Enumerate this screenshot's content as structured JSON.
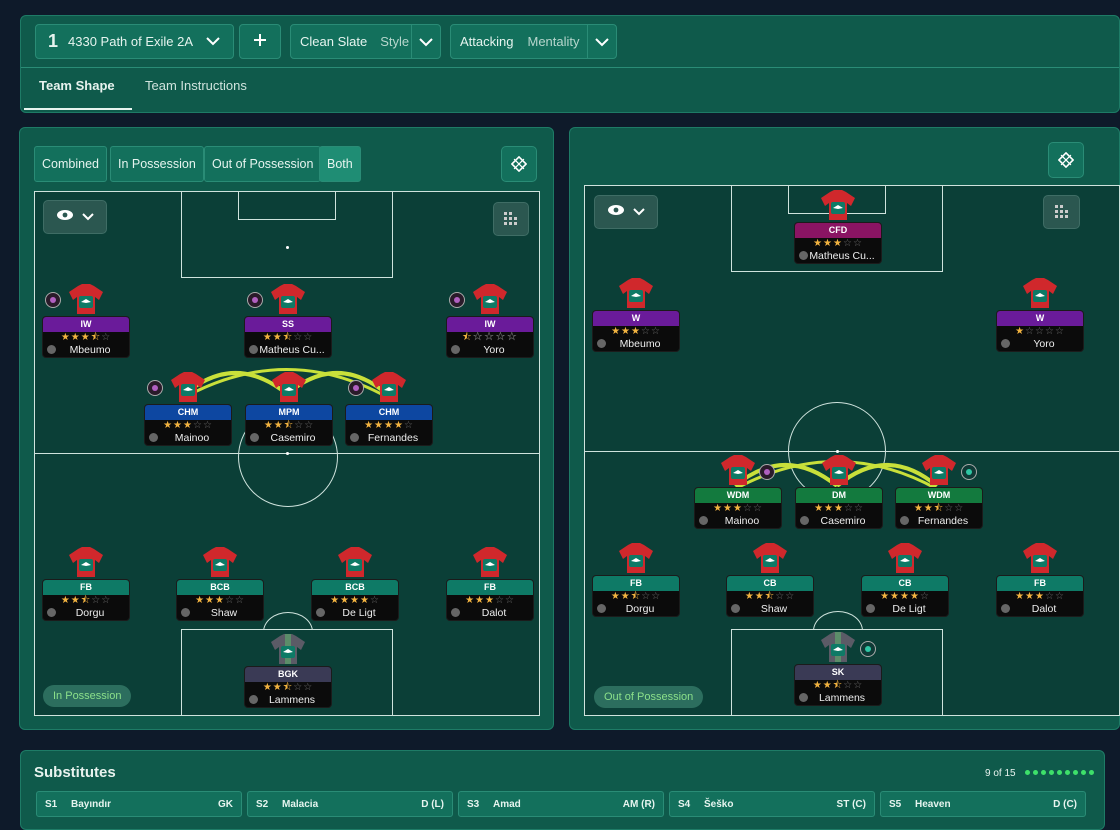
{
  "tactic": {
    "number": "1",
    "name": "4330 Path of Exile 2A",
    "style_value": "Clean Slate",
    "style_label": "Style",
    "mentality_value": "Attacking",
    "mentality_label": "Mentality"
  },
  "tabs": [
    "Team Shape",
    "Team Instructions"
  ],
  "view_modes": [
    "Combined",
    "In Possession",
    "Out of Possession",
    "Both"
  ],
  "left_pitch": {
    "label": "In Possession",
    "players": [
      {
        "role": "IW",
        "name": "Mbeumo",
        "stars": "★★★⯪☆"
      },
      {
        "role": "SS",
        "name": "Matheus Cu...",
        "stars": "★★⯪☆☆"
      },
      {
        "role": "IW",
        "name": "Yoro",
        "stars": "⯪☆☆☆☆"
      },
      {
        "role": "CHM",
        "name": "Mainoo",
        "stars": "★★★☆☆"
      },
      {
        "role": "MPM",
        "name": "Casemiro",
        "stars": "★★⯪☆☆"
      },
      {
        "role": "CHM",
        "name": "Fernandes",
        "stars": "★★★★☆"
      },
      {
        "role": "FB",
        "name": "Dorgu",
        "stars": "★★⯪☆☆"
      },
      {
        "role": "BCB",
        "name": "Shaw",
        "stars": "★★★☆☆"
      },
      {
        "role": "BCB",
        "name": "De Ligt",
        "stars": "★★★★☆"
      },
      {
        "role": "FB",
        "name": "Dalot",
        "stars": "★★★☆☆"
      },
      {
        "role": "BGK",
        "name": "Lammens",
        "stars": "★★⯪☆☆"
      }
    ]
  },
  "right_pitch": {
    "label": "Out of Possession",
    "players": [
      {
        "role": "CFD",
        "name": "Matheus Cu...",
        "stars": "★★★☆☆"
      },
      {
        "role": "W",
        "name": "Mbeumo",
        "stars": "★★★☆☆"
      },
      {
        "role": "W",
        "name": "Yoro",
        "stars": "★☆☆☆☆"
      },
      {
        "role": "WDM",
        "name": "Mainoo",
        "stars": "★★★☆☆"
      },
      {
        "role": "DM",
        "name": "Casemiro",
        "stars": "★★★☆☆"
      },
      {
        "role": "WDM",
        "name": "Fernandes",
        "stars": "★★⯪☆☆"
      },
      {
        "role": "FB",
        "name": "Dorgu",
        "stars": "★★⯪☆☆"
      },
      {
        "role": "CB",
        "name": "Shaw",
        "stars": "★★⯪☆☆"
      },
      {
        "role": "CB",
        "name": "De Ligt",
        "stars": "★★★★☆"
      },
      {
        "role": "FB",
        "name": "Dalot",
        "stars": "★★★☆☆"
      },
      {
        "role": "SK",
        "name": "Lammens",
        "stars": "★★⯪☆☆"
      }
    ]
  },
  "substitutes": {
    "title": "Substitutes",
    "count": "9 of 15",
    "items": [
      {
        "code": "S1",
        "name": "Bayındır",
        "pos": "GK"
      },
      {
        "code": "S2",
        "name": "Malacia",
        "pos": "D (L)"
      },
      {
        "code": "S3",
        "name": "Amad",
        "pos": "AM (R)"
      },
      {
        "code": "S4",
        "name": "Šeško",
        "pos": "ST (C)"
      },
      {
        "code": "S5",
        "name": "Heaven",
        "pos": "D (C)"
      }
    ]
  },
  "colors": {
    "attack": "#6a1b9a",
    "mid": "#0d47a1",
    "def": "#0e7a66",
    "gk": "#3a3a55",
    "dm": "#137a3e",
    "cfd": "#8a1463"
  },
  "icons": {
    "expand": "chevron-down-icon",
    "add": "plus-icon",
    "eye": "eye-icon",
    "grid": "grid-icon",
    "pitch": "pitch-toggle-icon"
  }
}
